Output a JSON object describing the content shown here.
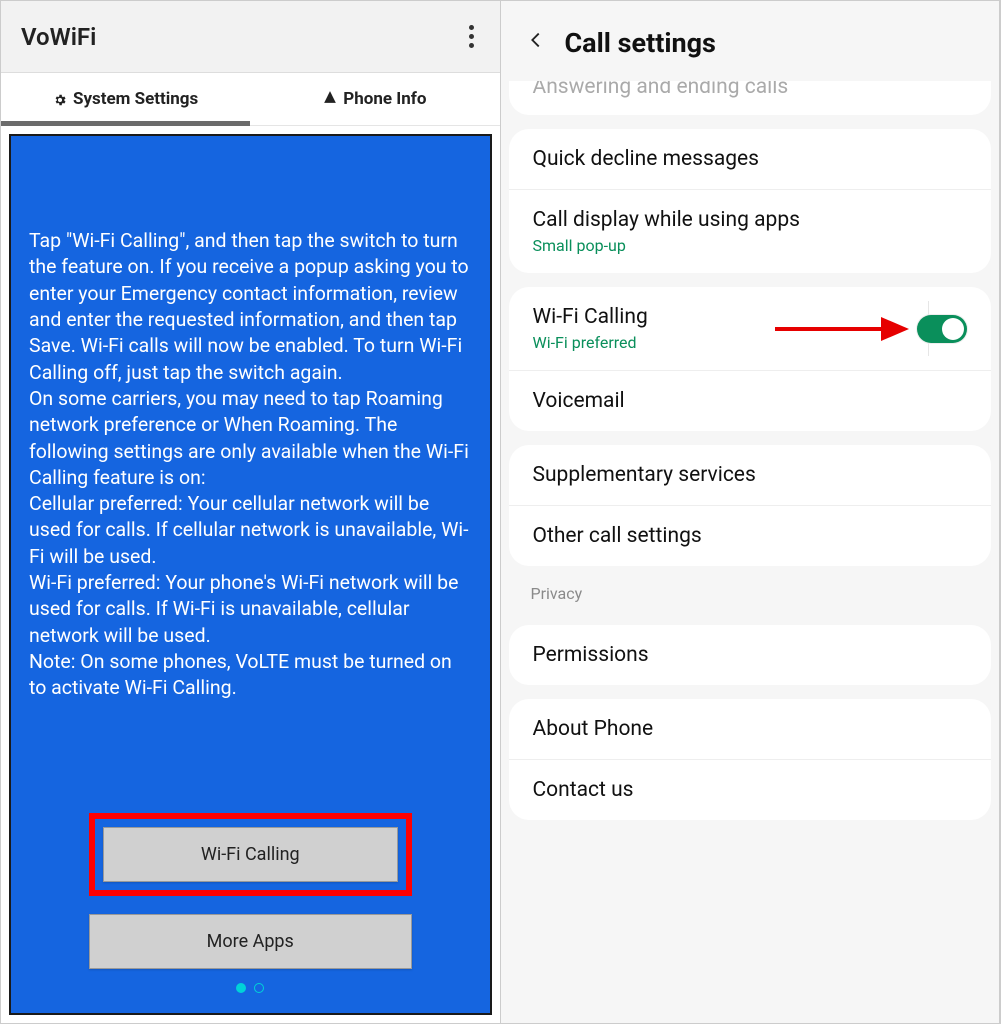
{
  "left": {
    "title": "VoWiFi",
    "tabs": {
      "system": "System Settings",
      "phone": "Phone Info"
    },
    "paragraphs": [
      "Tap \"Wi-Fi Calling\", and then tap the switch to turn the feature on. If you receive a popup asking you to enter your Emergency contact information, review and enter the requested information, and then tap Save. Wi-Fi calls will now be enabled. To turn Wi-Fi Calling off, just tap the switch again.",
      "On some carriers, you may need to tap Roaming network preference or When Roaming. The following settings are only available when the Wi-Fi Calling feature is on:",
      "Cellular preferred: Your cellular network will be used for calls. If cellular network is unavailable, Wi-Fi will be used.",
      "Wi-Fi preferred: Your phone's Wi-Fi network will be used for calls. If Wi-Fi is unavailable, cellular network will be used.",
      "Note: On some phones, VoLTE must be turned on to activate Wi-Fi Calling."
    ],
    "buttons": {
      "wifi": "Wi-Fi Calling",
      "more": "More Apps"
    }
  },
  "right": {
    "title": "Call settings",
    "cut": "Answering and ending calls",
    "rows": {
      "quick_decline": "Quick decline messages",
      "call_display": "Call display while using apps",
      "call_display_sub": "Small pop-up",
      "wifi_calling": "Wi-Fi Calling",
      "wifi_calling_sub": "Wi-Fi preferred",
      "voicemail": "Voicemail",
      "supplementary": "Supplementary services",
      "other": "Other call settings",
      "privacy_section": "Privacy",
      "permissions": "Permissions",
      "about": "About Phone",
      "contact": "Contact us"
    }
  }
}
